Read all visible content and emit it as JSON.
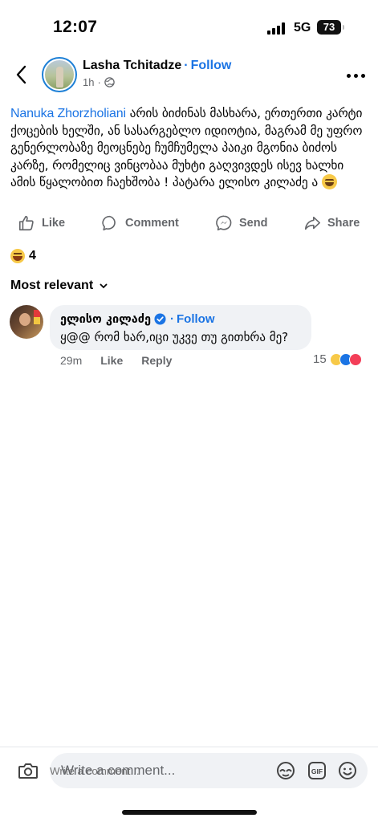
{
  "status": {
    "time": "12:07",
    "network": "5G",
    "battery": "73"
  },
  "post": {
    "author": "Lasha Tchitadze",
    "separator": "·",
    "follow_label": "Follow",
    "time": "1h",
    "mention": "Nanuka Zhorzholiani",
    "text": " არის ბიძინას მასხარა,  ერთერთი კარტი ქოცების ხელში, ან სასარგებლო იდიოტია, მაგრამ მე უფრო გენერლობაზე მეოცნებე ჩუმჩუმელა პაიკი მგონია ბიძოს კარზე, რომელიც ვინცობაა მუხტი გაღვივდეს ისევ ხალხი ამის წყალობით ჩაეხშობა ! პატარა  ელისო კილაძე ა ",
    "emoji": "face-with-tears-of-joy"
  },
  "actions": {
    "like": "Like",
    "comment": "Comment",
    "send": "Send",
    "share": "Share"
  },
  "reactions": {
    "count": "4"
  },
  "sort": {
    "label": "Most relevant"
  },
  "comment": {
    "author": "ელისო კილაძე",
    "separator": "·",
    "follow_label": "Follow",
    "text": "ყ@@ რომ ხარ,იცი უკვე თუ გითხრა მე?",
    "time": "29m",
    "like_label": "Like",
    "reply_label": "Reply",
    "reaction_count": "15"
  },
  "composer": {
    "placeholder": "Write a comment..."
  },
  "colors": {
    "accent": "#1b74e4",
    "secondary_text": "#65676b",
    "bubble": "#f0f2f5"
  }
}
